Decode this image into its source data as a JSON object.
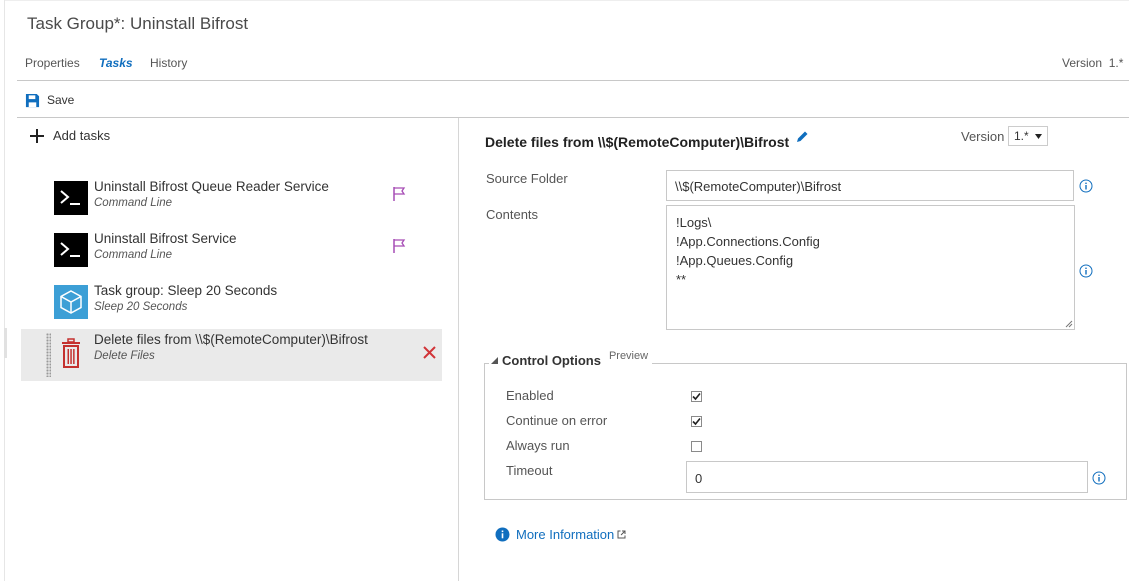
{
  "header": {
    "title": "Task Group*: Uninstall Bifrost",
    "tabs": [
      "Properties",
      "Tasks",
      "History"
    ],
    "version_label": "Version",
    "version_value": "1.*"
  },
  "toolbar": {
    "save_label": "Save"
  },
  "task_list": {
    "add_label": "Add tasks",
    "tasks": [
      {
        "name": "Uninstall Bifrost Queue Reader Service",
        "sub": "Command Line",
        "icon": "terminal-icon"
      },
      {
        "name": "Uninstall Bifrost Service",
        "sub": "Command Line",
        "icon": "terminal-icon"
      },
      {
        "name": "Task group: Sleep 20 Seconds",
        "sub": "Sleep 20 Seconds",
        "icon": "cube-icon"
      },
      {
        "name": "Delete files from \\\\$(RemoteComputer)\\Bifrost",
        "sub": "Delete Files",
        "icon": "trash-icon"
      }
    ]
  },
  "detail": {
    "title": "Delete files from \\\\$(RemoteComputer)\\Bifrost",
    "version_label": "Version",
    "version_value": "1.*",
    "source_folder_label": "Source Folder",
    "source_folder_value": "\\\\$(RemoteComputer)\\Bifrost",
    "contents_label": "Contents",
    "contents_lines": [
      "!Logs\\",
      "!App.Connections.Config",
      "!App.Queues.Config",
      "**"
    ],
    "control_options": {
      "title": "Control Options",
      "preview": "Preview",
      "enabled_label": "Enabled",
      "enabled": true,
      "continue_label": "Continue on error",
      "continue": true,
      "always_label": "Always run",
      "always": false,
      "timeout_label": "Timeout",
      "timeout_value": "0"
    },
    "more_info_label": "More Information"
  },
  "colors": {
    "accent": "#106ebe",
    "flag": "#a64cb5",
    "delete": "#d13438",
    "selected_bg": "#eaeaea"
  }
}
